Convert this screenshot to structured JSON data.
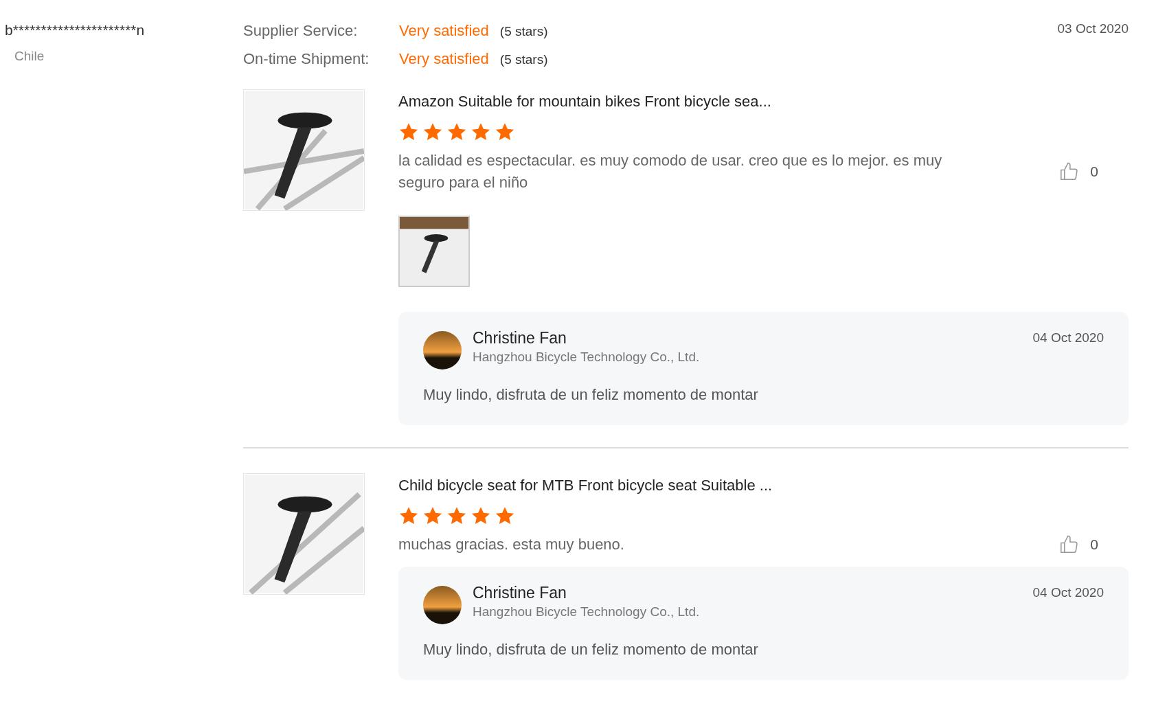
{
  "buyer": {
    "name": "b**********************n",
    "country": "Chile"
  },
  "date": "03 Oct 2020",
  "ratings": [
    {
      "label": "Supplier Service:",
      "value": "Very satisfied",
      "stars_text": "(5 stars)"
    },
    {
      "label": "On-time Shipment:",
      "value": "Very satisfied",
      "stars_text": "(5 stars)"
    }
  ],
  "reviews": [
    {
      "product_title": "Amazon Suitable for mountain bikes Front bicycle sea...",
      "stars": 5,
      "text": "la calidad es espectacular. es muy comodo de usar. creo que es lo mejor. es muy seguro para  el niño",
      "likes": "0",
      "has_attachment": true,
      "reply": {
        "name": "Christine Fan",
        "company": "Hangzhou Bicycle Technology Co., Ltd.",
        "date": "04 Oct 2020",
        "text": "Muy lindo, disfruta de un feliz momento de montar"
      }
    },
    {
      "product_title": "Child bicycle seat for MTB Front bicycle seat Suitable ...",
      "stars": 5,
      "text": "muchas gracias. esta muy bueno.",
      "likes": "0",
      "has_attachment": false,
      "reply": {
        "name": "Christine Fan",
        "company": "Hangzhou Bicycle Technology Co., Ltd.",
        "date": "04 Oct 2020",
        "text": "Muy lindo, disfruta de un feliz momento de montar"
      }
    }
  ]
}
